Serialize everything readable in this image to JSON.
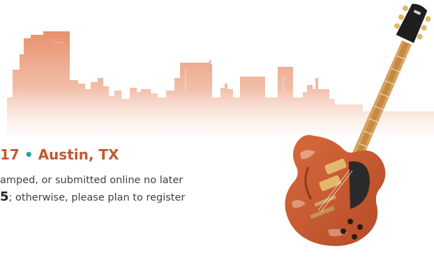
{
  "headline": {
    "year_fragment": "17",
    "separator": "•",
    "location": "Austin, TX"
  },
  "notice": {
    "line1": "amped, or submitted online no later",
    "line2_date_fragment": "5",
    "line2_rest": "; otherwise, please plan to register"
  },
  "colors": {
    "skyline": "#e8906b",
    "headline": "#bf5a33",
    "separator_dot": "#1fa79b",
    "guitar_body": "#c85a32",
    "guitar_neck": "#d9a15c",
    "pickguard": "#2a2a2a"
  },
  "icons": {
    "skyline": "city-skyline-illustration",
    "guitar": "electric-guitar-illustration"
  }
}
